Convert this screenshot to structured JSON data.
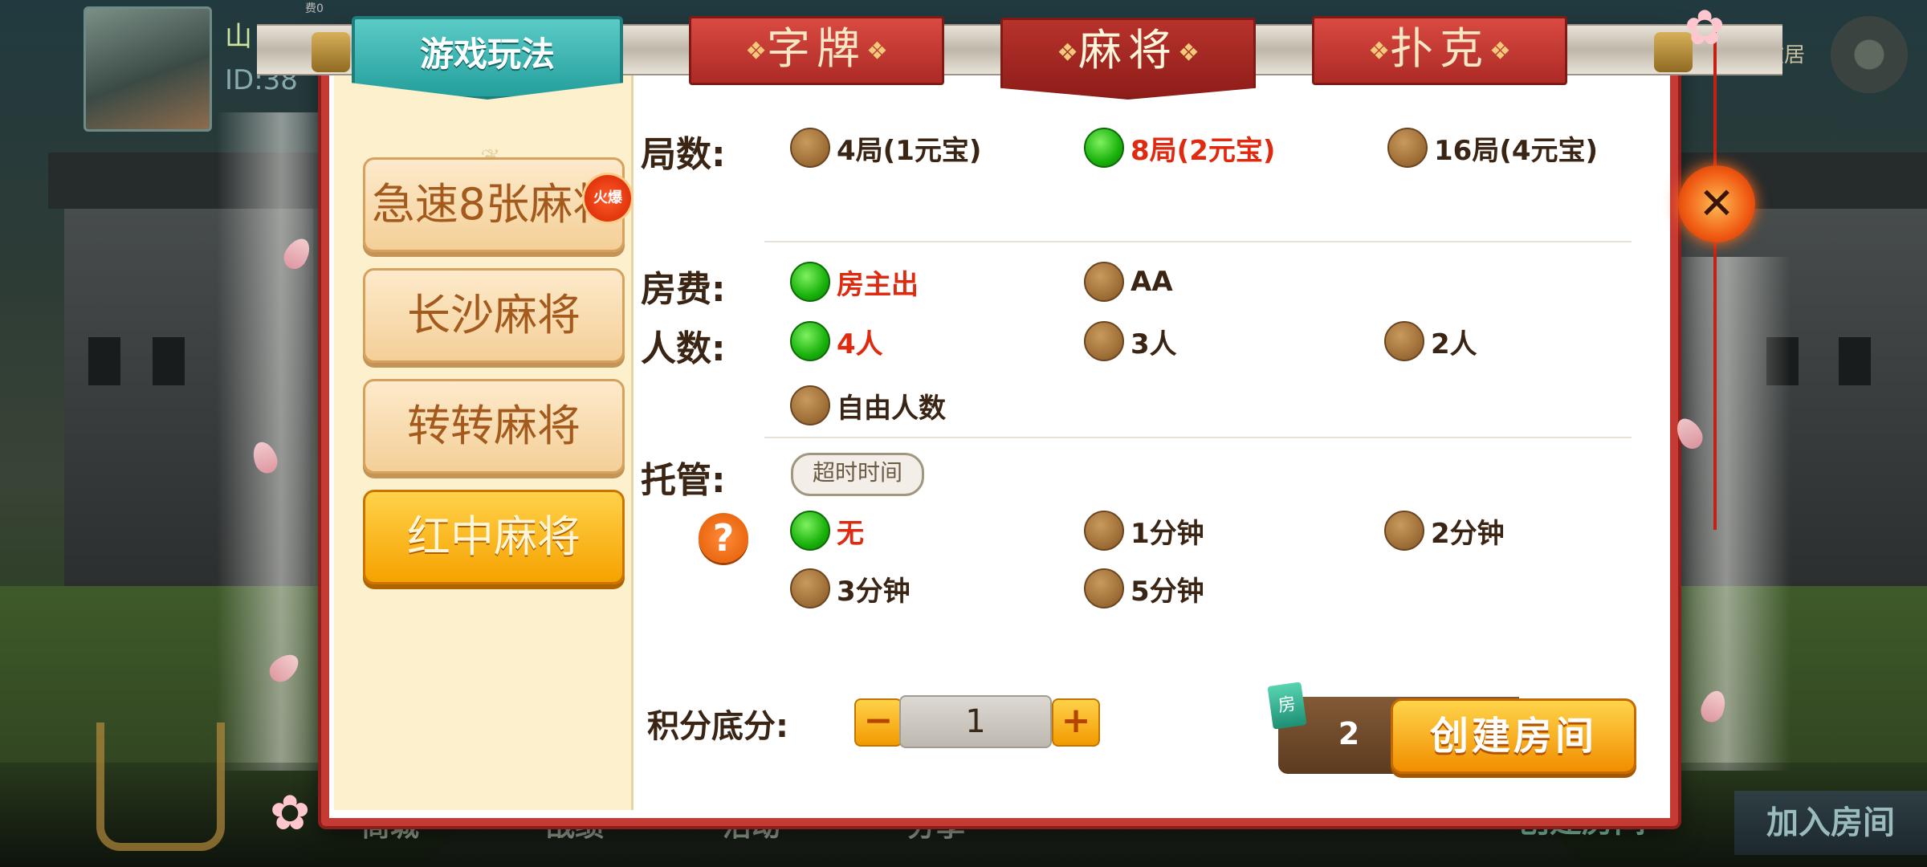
{
  "player": {
    "name": "山",
    "id_prefix": "ID:38",
    "badge": "费0"
  },
  "top_right": {
    "notice": "公故居"
  },
  "bottom_bar": {
    "items": [
      "商城",
      "战绩",
      "活动",
      "分享"
    ],
    "create_room": "创建房间",
    "join_room": "加入房间"
  },
  "dialog": {
    "title": "游戏玩法",
    "category_tabs": [
      {
        "label": "字牌",
        "active": false
      },
      {
        "label": "麻将",
        "active": true
      },
      {
        "label": "扑克",
        "active": false
      }
    ],
    "games": [
      {
        "label": "急速8张麻将",
        "badge": "火爆",
        "active": false
      },
      {
        "label": "长沙麻将",
        "active": false
      },
      {
        "label": "转转麻将",
        "active": false
      },
      {
        "label": "红中麻将",
        "active": true
      }
    ],
    "rounds": {
      "label": "局数:",
      "options": [
        {
          "label": "4局(1元宝)",
          "selected": false
        },
        {
          "label": "8局(2元宝)",
          "selected": true
        },
        {
          "label": "16局(4元宝)",
          "selected": false
        }
      ]
    },
    "room_fee": {
      "label": "房费:",
      "options": [
        {
          "label": "房主出",
          "selected": true
        },
        {
          "label": "AA",
          "selected": false
        }
      ]
    },
    "players": {
      "label": "人数:",
      "options": [
        {
          "label": "4人",
          "selected": true
        },
        {
          "label": "3人",
          "selected": false
        },
        {
          "label": "2人",
          "selected": false
        },
        {
          "label": "自由人数",
          "selected": false
        }
      ]
    },
    "auto_play": {
      "label": "托管:",
      "pill": "超时时间",
      "help": "?",
      "options": [
        {
          "label": "无",
          "selected": true
        },
        {
          "label": "1分钟",
          "selected": false
        },
        {
          "label": "2分钟",
          "selected": false
        },
        {
          "label": "3分钟",
          "selected": false
        },
        {
          "label": "5分钟",
          "selected": false
        }
      ]
    },
    "score": {
      "label": "积分底分:",
      "value": "1",
      "minus": "−",
      "plus": "+"
    },
    "create": {
      "card_icon": "房",
      "cost": "2",
      "button": "创建房间"
    },
    "close": "✕"
  },
  "colors": {
    "accent_red": "#c63a34",
    "selected_green": "#19b20c",
    "selected_text": "#e02a10",
    "button_orange": "#f6a200"
  }
}
